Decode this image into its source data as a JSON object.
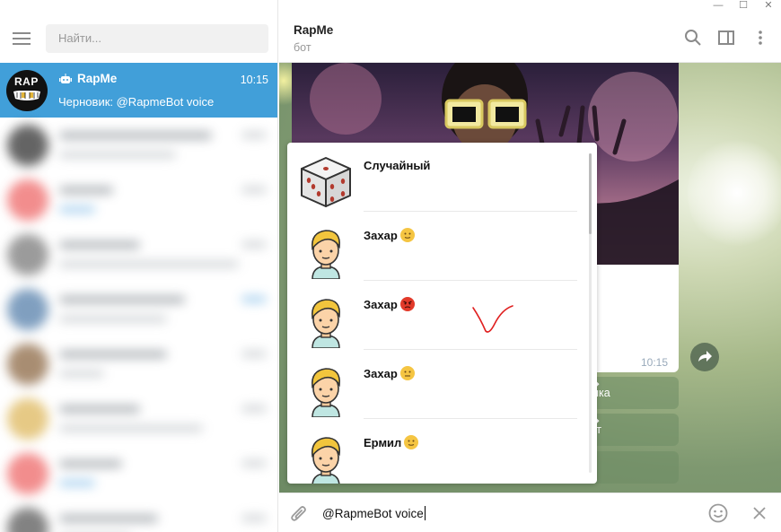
{
  "window": {
    "minimize_glyph": "—",
    "maximize_glyph": "☐",
    "close_glyph": "✕"
  },
  "sidebar": {
    "search_placeholder": "Найти...",
    "active_chat": {
      "avatar_text": "RAP",
      "title": "RapMe",
      "time": "10:15",
      "preview": "Черновик: @RapmeBot voice"
    }
  },
  "header": {
    "title": "RapMe",
    "status": "бот"
  },
  "message": {
    "time": "10:15",
    "inline_buttons": [
      "ыка",
      "ст",
      ""
    ]
  },
  "inline_results": [
    {
      "title": "Случайный",
      "thumb": "dice-icon",
      "emoji": ""
    },
    {
      "title": "Захар",
      "thumb": "boy-avatar-icon",
      "emoji": "slight-smile"
    },
    {
      "title": "Захар",
      "thumb": "boy-avatar-icon",
      "emoji": "angry"
    },
    {
      "title": "Захар",
      "thumb": "boy-avatar-icon",
      "emoji": "neutral"
    },
    {
      "title": "Ермил",
      "thumb": "boy-avatar-icon",
      "emoji": "slight-smile"
    }
  ],
  "composer": {
    "text": "@RapmeBot voice"
  },
  "colors": {
    "accent": "#419fd9",
    "active_text": "#ffffff",
    "muted": "#999999"
  }
}
